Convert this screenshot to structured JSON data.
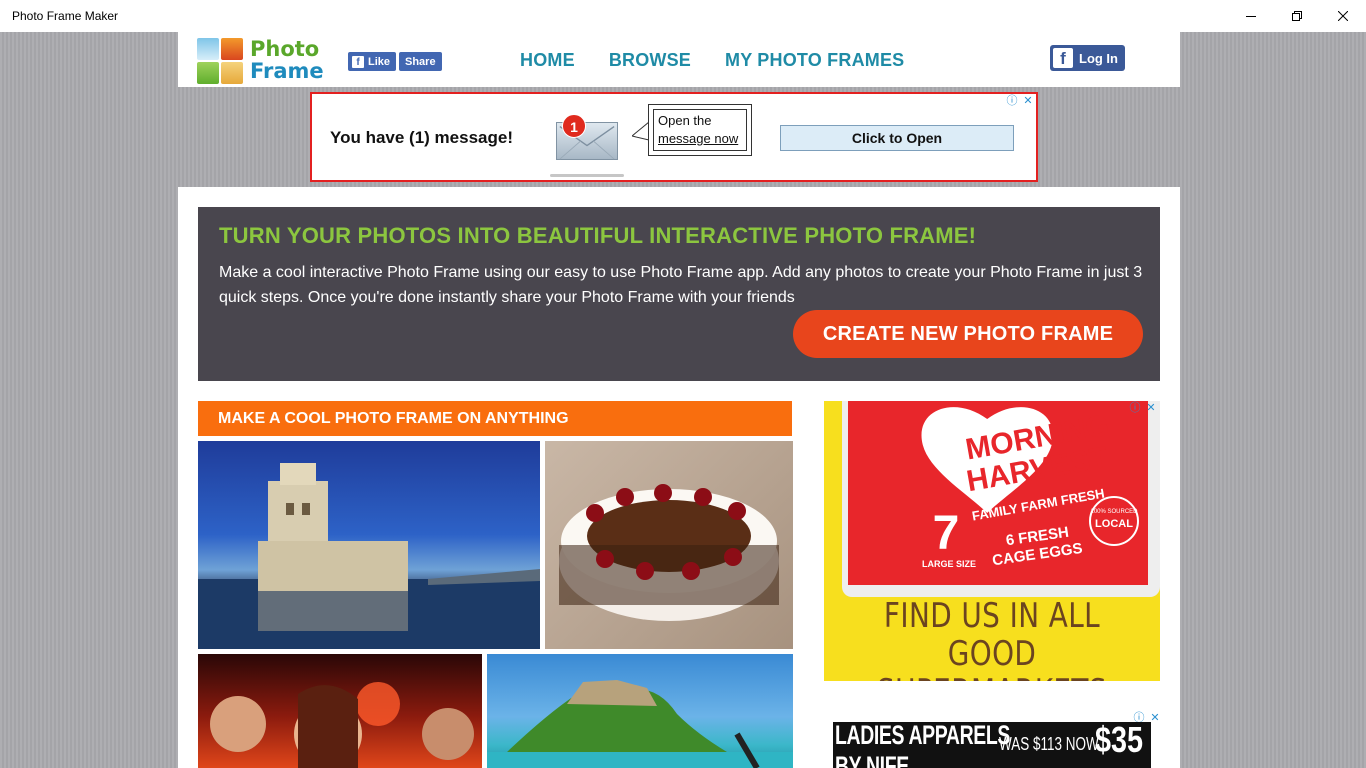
{
  "window": {
    "title": "Photo Frame Maker",
    "controls": {
      "minimize": "minimize-icon",
      "restore": "restore-icon",
      "close": "close-icon"
    }
  },
  "header": {
    "logo": {
      "line1": "Photo",
      "line2": "Frame"
    },
    "facebook": {
      "like_label": "Like",
      "share_label": "Share",
      "f_glyph": "f"
    },
    "nav": [
      {
        "label": "HOME"
      },
      {
        "label": "BROWSE"
      },
      {
        "label": "MY PHOTO FRAMES"
      }
    ],
    "login": {
      "label": "Log In",
      "f_glyph": "f"
    }
  },
  "top_ad": {
    "message": "You have (1) message!",
    "badge_count": "1",
    "bubble_line1": "Open the",
    "bubble_line2": "message now",
    "button_label": "Click to Open",
    "info_icon": "ⓘ",
    "close_icon": "✕"
  },
  "hero": {
    "heading": "TURN YOUR PHOTOS INTO BEAUTIFUL INTERACTIVE PHOTO FRAME!",
    "description": "Make a cool interactive Photo Frame using our easy to use Photo Frame app. Add any photos to create your Photo Frame in just 3 quick steps. Once you're done instantly share your Photo Frame with your friends",
    "cta_label": "CREATE NEW PHOTO FRAME"
  },
  "section": {
    "heading": "MAKE A COOL PHOTO FRAME ON ANYTHING"
  },
  "side_ad": {
    "brand_line1": "MORNING",
    "brand_line2": "HARVEST",
    "tagline": "FAMILY FARM FRESH",
    "count": "7",
    "size_label": "LARGE SIZE",
    "eggs_line1": "6 FRESH",
    "eggs_line2": "CAGE EGGS",
    "seal_line1": "100% SOURCED",
    "seal_line2": "LOCAL",
    "find_line1": "FIND US IN ALL",
    "find_line2": "GOOD SUPERMARKETS",
    "info_icon": "ⓘ",
    "close_icon": "✕"
  },
  "bottom_ad": {
    "headline": "LADIES APPARELS",
    "subline": "BY NIFE",
    "was_text": "WAS $113 NOW",
    "price": "$35",
    "info_icon": "ⓘ",
    "close_icon": "✕"
  },
  "colors": {
    "brand_teal": "#1f8ba6",
    "hero_bg": "#49464e",
    "hero_heading": "#8cc63f",
    "cta": "#e8451c",
    "section_head": "#f96e0e",
    "facebook": "#3b5998",
    "ad_border": "#e32020",
    "side_ad_bg": "#f7df1e"
  }
}
